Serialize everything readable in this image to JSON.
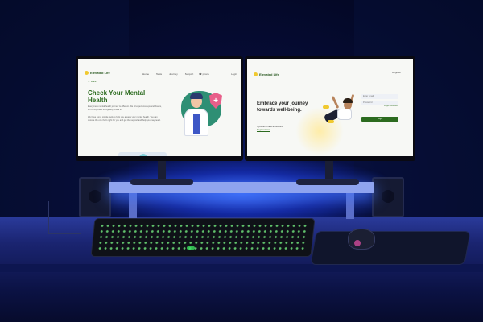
{
  "photo": {
    "description_colors": {
      "ambient": "#0b1a6a",
      "led_strip": "#3c6eff",
      "keyboard_keys": "#6ee07a"
    }
  },
  "left_screen": {
    "logo": "Elevated Life",
    "nav": [
      "Home",
      "Tests",
      "Journey",
      "Support"
    ],
    "phone": "☎ phone",
    "login": "Login",
    "back": "← Back",
    "title_line1": "Check Your Mental",
    "title_line2": "Health",
    "para1": "Everyone's mental health journey is different. We all experience ups and downs, so it's important to regularly check in.",
    "para2": "We have some simple tools to help you assess your mental health. You can choose the one that's right for you and get the support and help you may need.",
    "accent": "#2c6b1f"
  },
  "right_screen": {
    "logo": "Elevated Life",
    "register": "Register",
    "title_line1": "Embrace your journey",
    "title_line2": "towards well-being.",
    "no_account": "If you don't have an account",
    "register_here": "Register here!",
    "email_placeholder": "Enter email",
    "password_placeholder": "Password",
    "forgot": "Forgot password?",
    "login_button": "Login",
    "accent": "#2c6b1f"
  }
}
